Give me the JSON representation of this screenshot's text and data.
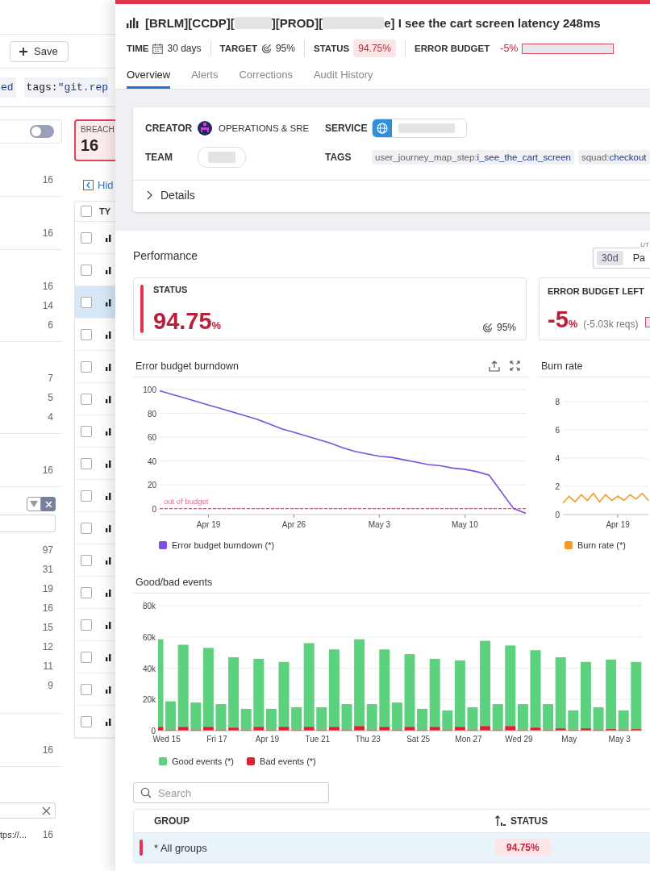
{
  "background": {
    "save_button": "Save",
    "query": {
      "chip": "ed",
      "tag_key": "tags:",
      "tag_value": "\"git.rep"
    },
    "facet_toggle": {
      "on": false
    },
    "facets": [
      {
        "kind": "plain",
        "counts": [
          "16"
        ]
      },
      {
        "kind": "plain",
        "counts": [
          "16"
        ]
      },
      {
        "kind": "plain",
        "counts": [
          "16",
          "14",
          "6"
        ]
      },
      {
        "kind": "plain",
        "counts": [
          "7",
          "5",
          "4"
        ]
      },
      {
        "kind": "plain",
        "counts": [
          "16"
        ]
      },
      {
        "kind": "filter",
        "counts": [
          "97",
          "31",
          "19",
          "16",
          "15",
          "12",
          "11",
          "9"
        ]
      },
      {
        "kind": "plain",
        "counts": [
          "16"
        ]
      },
      {
        "kind": "search",
        "value": "tps://...",
        "counts": [
          "16"
        ]
      }
    ],
    "breach_card": {
      "label": "BREACH",
      "count": "16"
    },
    "hide_link": "Hid",
    "table": {
      "column_1": "TY",
      "header_checked": false,
      "rows": [
        {
          "checked": false,
          "selected": false
        },
        {
          "checked": false,
          "selected": false
        },
        {
          "checked": false,
          "selected": true
        },
        {
          "checked": false,
          "selected": false
        },
        {
          "checked": false,
          "selected": false
        },
        {
          "checked": false,
          "selected": false
        },
        {
          "checked": false,
          "selected": false
        },
        {
          "checked": false,
          "selected": false
        },
        {
          "checked": false,
          "selected": false
        },
        {
          "checked": false,
          "selected": false
        },
        {
          "checked": false,
          "selected": false
        },
        {
          "checked": false,
          "selected": false
        },
        {
          "checked": false,
          "selected": false
        },
        {
          "checked": false,
          "selected": false
        },
        {
          "checked": false,
          "selected": false
        },
        {
          "checked": false,
          "selected": false
        }
      ]
    }
  },
  "slo_panel": {
    "title": [
      {
        "kind": "text",
        "text": "[BRLM][CCDP]["
      },
      {
        "kind": "redacted"
      },
      {
        "kind": "text",
        "text": "][PROD]["
      },
      {
        "kind": "redacted"
      },
      {
        "kind": "text",
        "text": "e] I see the cart screen latency 248ms"
      }
    ],
    "meta": {
      "time_label": "TIME",
      "time_value": "30 days",
      "target_label": "TARGET",
      "target_value": "95%",
      "status_label": "STATUS",
      "status_value": "94.75%",
      "error_budget_label": "ERROR BUDGET",
      "error_budget_value": "-5%"
    },
    "tabs": [
      {
        "label": "Overview",
        "selected": true
      },
      {
        "label": "Alerts",
        "selected": false
      },
      {
        "label": "Corrections",
        "selected": false
      },
      {
        "label": "Audit History",
        "selected": false
      }
    ],
    "info": {
      "creator_label": "CREATOR",
      "creator": "OPERATIONS & SRE",
      "service_label": "SERVICE",
      "team_label": "TEAM",
      "tags_label": "TAGS",
      "tags": [
        {
          "key": "user_journey_map_step:",
          "value": "i_see_the_cart_screen"
        },
        {
          "key": "squad:",
          "value": "checkout"
        }
      ],
      "details": "Details",
      "details_expanded": false
    },
    "performance": {
      "title": "Performance",
      "range_legend": "UT",
      "range_options": [
        {
          "label": "30d",
          "selected": true
        },
        {
          "label": "Pa",
          "selected": false
        }
      ],
      "status_card": {
        "label": "STATUS",
        "value": "94.75",
        "unit": "%",
        "target": "95%"
      },
      "budget_card": {
        "label": "ERROR BUDGET LEFT",
        "value": "-5",
        "unit": "%",
        "note": "(-5.03k reqs)"
      }
    },
    "burndown": {
      "title": "Error budget burndown",
      "chart_data": {
        "type": "line",
        "categories": [
          null,
          null,
          null,
          null,
          "Apr 19",
          null,
          null,
          null,
          null,
          null,
          null,
          "Apr 26",
          null,
          null,
          null,
          null,
          null,
          null,
          "May 3",
          null,
          null,
          null,
          null,
          null,
          null,
          "May 10",
          null,
          null,
          null,
          null,
          null
        ],
        "series": [
          {
            "name": "Error budget burndown (*)",
            "color": "#7b4fe0",
            "values": [
              99,
              96,
              93,
              90,
              87,
              84,
              81,
              78,
              75,
              71,
              67,
              64,
              61,
              58,
              55,
              51,
              48,
              46,
              44,
              43,
              41,
              39,
              37,
              36,
              34,
              33,
              31,
              28,
              14,
              0,
              -4
            ]
          }
        ],
        "ylim": [
          -5,
          100
        ],
        "yticks": [
          0,
          20,
          40,
          60,
          80,
          100
        ],
        "grid": true,
        "ref_lines": [
          {
            "axis": "y",
            "value": 0,
            "label": "out of budget"
          }
        ]
      }
    },
    "burn_rate": {
      "title": "Burn rate",
      "chart_data": {
        "type": "line",
        "categories": [
          null,
          null,
          null,
          null,
          null,
          null,
          null,
          null,
          null,
          "Apr 19",
          null,
          null,
          null,
          null,
          null
        ],
        "series": [
          {
            "name": "Burn rate (*)",
            "color": "#f59b23",
            "values": [
              0.8,
              1.3,
              0.9,
              1.4,
              1.0,
              1.5,
              0.9,
              1.4,
              1.0,
              1.3,
              1.0,
              1.4,
              1.1,
              1.5,
              1.0
            ]
          }
        ],
        "ylim": [
          0,
          8
        ],
        "yticks": [
          0,
          2,
          4,
          6,
          8
        ],
        "grid": true
      }
    },
    "events": {
      "title": "Good/bad events",
      "chart_data": {
        "type": "bar",
        "stacked": true,
        "categories": [
          null,
          "Wed 15",
          null,
          null,
          null,
          "Fri 17",
          null,
          null,
          null,
          "Apr 19",
          null,
          null,
          null,
          "Tue 21",
          null,
          null,
          null,
          "Thu 23",
          null,
          null,
          null,
          "Sat 25",
          null,
          null,
          null,
          "Mon 27",
          null,
          null,
          null,
          "Wed 29",
          null,
          null,
          null,
          "May",
          null,
          null,
          null,
          "May 3",
          null
        ],
        "series": [
          {
            "name": "Good events (*)",
            "color": "#5cd17e",
            "values": [
              56000,
              18000,
              52500,
              17200,
              50500,
              16200,
              45000,
              13200,
              43500,
              13200,
              41500,
              14200,
              53500,
              14200,
              49500,
              16200,
              55500,
              16200,
              49500,
              17200,
              46500,
              13200,
              43500,
              12200,
              42500,
              14200,
              54500,
              16200,
              51500,
              16200,
              49500,
              16200,
              45500,
              12200,
              42500,
              14200,
              44500,
              12200,
              43000
            ]
          },
          {
            "name": "Bad events (*)",
            "color": "#e0202e",
            "values": [
              2500,
              800,
              2500,
              800,
              2500,
              800,
              2000,
              800,
              2500,
              800,
              2500,
              800,
              2500,
              800,
              2500,
              800,
              3000,
              800,
              2500,
              800,
              2500,
              800,
              2500,
              800,
              2500,
              800,
              3000,
              800,
              3000,
              800,
              2000,
              800,
              1500,
              800,
              1500,
              800,
              1000,
              800,
              1000
            ]
          }
        ],
        "ylim": [
          0,
          80000
        ],
        "grid": true,
        "yticks": [
          {
            "value": 0,
            "label": "0"
          },
          {
            "value": 20000,
            "label": "20k"
          },
          {
            "value": 40000,
            "label": "40k"
          },
          {
            "value": 60000,
            "label": "60k"
          },
          {
            "value": 80000,
            "label": "80k"
          }
        ]
      }
    },
    "groups": {
      "search_placeholder": "Search",
      "columns": [
        "GROUP",
        "STATUS"
      ],
      "rows": [
        {
          "group": "* All groups",
          "status": "94.75%",
          "selected": true
        }
      ]
    }
  }
}
